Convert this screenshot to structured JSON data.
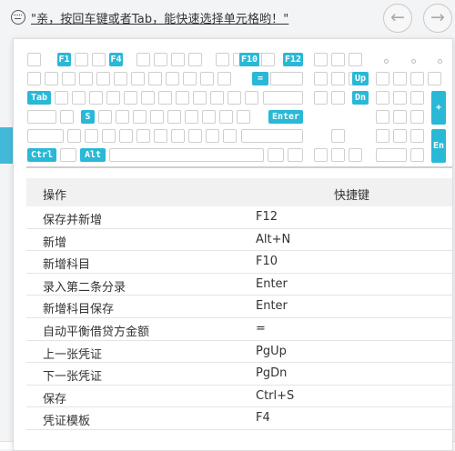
{
  "hint_bar": {
    "text": "\"亲，按回车键或者Tab，能快速选择单元格哟！\"",
    "back_icon": "arrow-left-icon",
    "forward_icon": "arrow-right-icon"
  },
  "keyboard": {
    "highlighted_keys": [
      "F1",
      "F4",
      "F10",
      "F12",
      "=",
      "Up",
      "Tab",
      "Dn",
      "+",
      "S",
      "Enter",
      "Ctrl",
      "Alt",
      "En"
    ],
    "highlight_color": "#29b8d6"
  },
  "shortcuts": {
    "headers": {
      "action": "操作",
      "key": "快捷键"
    },
    "rows": [
      {
        "action": "保存并新增",
        "key": "F12"
      },
      {
        "action": "新增",
        "key": "Alt+N"
      },
      {
        "action": "新增科目",
        "key": "F10"
      },
      {
        "action": "录入第二条分录",
        "key": "Enter"
      },
      {
        "action": "新增科目保存",
        "key": "Enter"
      },
      {
        "action": "自动平衡借贷方金额",
        "key": "="
      },
      {
        "action": "上一张凭证",
        "key": "PgUp"
      },
      {
        "action": "下一张凭证",
        "key": "PgDn"
      },
      {
        "action": "保存",
        "key": "Ctrl+S"
      },
      {
        "action": "凭证模板",
        "key": "F4"
      }
    ]
  }
}
